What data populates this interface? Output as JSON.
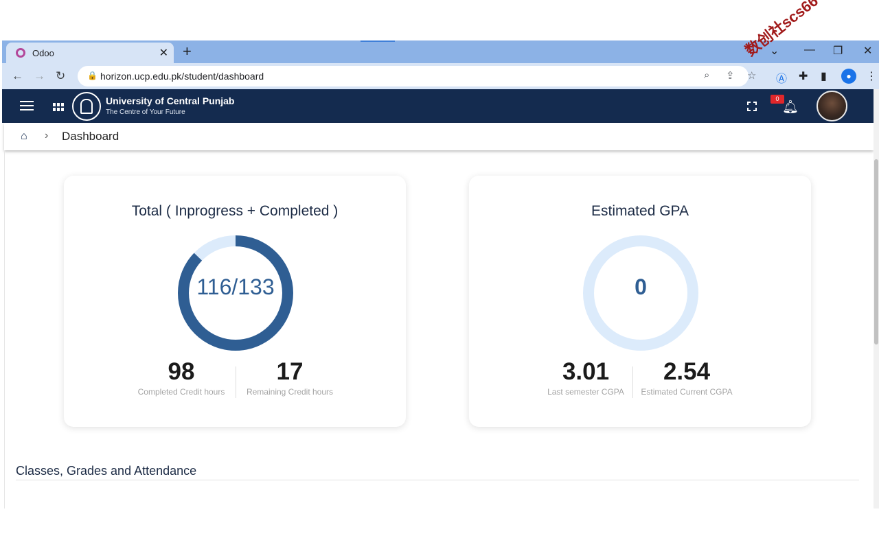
{
  "browser": {
    "tab_title": "Odoo",
    "tab_close": "✕",
    "new_tab": "+",
    "url": "horizon.ucp.edu.pk/student/dashboard"
  },
  "header": {
    "university_name": "University of Central Punjab",
    "tagline": "The Centre of Your Future",
    "notification_count": "0"
  },
  "breadcrumb": {
    "current": "Dashboard"
  },
  "credits_card": {
    "title": "Total ( Inprogress + Completed )",
    "ring_label": "116/133",
    "progress_fraction": 0.872,
    "completed_value": "98",
    "completed_label": "Completed Credit hours",
    "remaining_value": "17",
    "remaining_label": "Remaining Credit hours"
  },
  "gpa_card": {
    "title": "Estimated GPA",
    "ring_label": "0",
    "last_value": "3.01",
    "last_label": "Last semester CGPA",
    "current_value": "2.54",
    "current_label": "Estimated Current CGPA"
  },
  "section": {
    "title": "Classes, Grades and Attendance"
  },
  "watermark": "数创社scs66",
  "colors": {
    "header_bg": "#142b4f",
    "ring_fill": "#2f5e93",
    "ring_track": "#dcebfb",
    "badge": "#e0272b"
  }
}
